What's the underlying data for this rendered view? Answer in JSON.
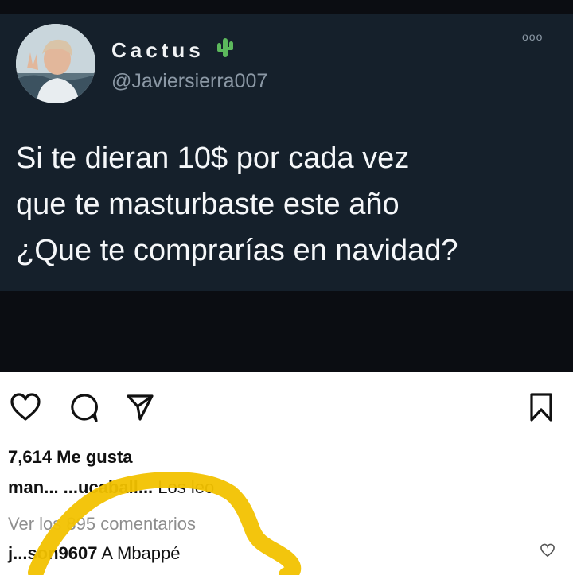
{
  "tweet": {
    "display_name": "Cactus",
    "handle": "@Javiersierra007",
    "more_icon": "ooo",
    "text_lines": [
      "Si te dieran 10$ por cada vez",
      "que te masturbaste este año",
      "¿Que te comprarías en navidad?"
    ]
  },
  "post": {
    "actions": [
      "heart-icon",
      "comment-icon",
      "share-icon",
      "bookmark-icon"
    ],
    "likes": "7,614 Me gusta",
    "caption": {
      "user": "man... ...ucaball...",
      "text": " Los leo"
    },
    "view_comments": "Ver los 895 comentarios",
    "comment": {
      "user": "j...son9607",
      "text": " A Mbappé"
    }
  },
  "colors": {
    "tweet_bg": "#15202b",
    "highlight": "#f2c200"
  }
}
